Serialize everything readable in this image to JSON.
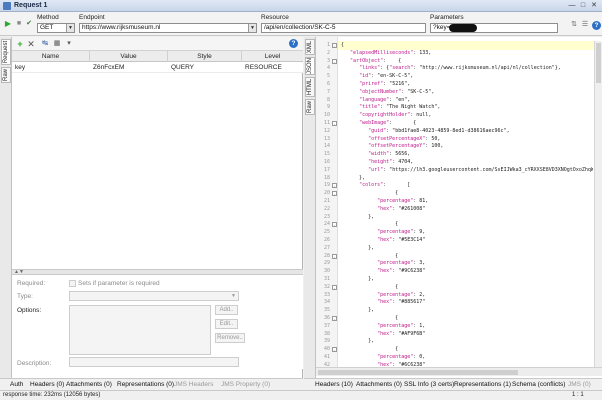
{
  "window": {
    "title": "Request 1"
  },
  "toolbar": {
    "method_label": "Method",
    "method_value": "GET",
    "endpoint_label": "Endpoint",
    "endpoint_value": "https://www.rijksmuseum.nl",
    "resource_label": "Resource",
    "resource_value": "/api/en/collection/SK-C-5",
    "parameters_label": "Parameters",
    "parameters_value": "?key="
  },
  "request_tabs": {
    "request": "Request",
    "raw": "Raw"
  },
  "params_table": {
    "headers": [
      "Name",
      "Value",
      "Style",
      "Level"
    ],
    "rows": [
      {
        "name": "key",
        "value": "Z6nFcxEM",
        "style": "QUERY",
        "level": "RESOURCE"
      }
    ]
  },
  "param_props": {
    "required_label": "Required:",
    "required_checkbox_label": "Sets if parameter is required",
    "type_label": "Type:",
    "options_label": "Options:",
    "description_label": "Description:",
    "add_button": "Add..",
    "edit_button": "Edit..",
    "remove_button": "Remove.."
  },
  "bottom_tabs_left": [
    {
      "label": "Auth",
      "enabled": true
    },
    {
      "label": "Headers (0)",
      "enabled": true
    },
    {
      "label": "Attachments (0)",
      "enabled": true
    },
    {
      "label": "Representations (0)",
      "enabled": true
    },
    {
      "label": "JMS Headers",
      "enabled": false
    },
    {
      "label": "JMS Property (0)",
      "enabled": false
    }
  ],
  "response_tabs": {
    "xml": "XML",
    "json": "JSON",
    "html": "HTML",
    "raw": "Raw"
  },
  "bottom_tabs_right": [
    {
      "label": "Headers (10)",
      "enabled": true
    },
    {
      "label": "Attachments (0)",
      "enabled": true
    },
    {
      "label": "SSL Info (3 certs)",
      "enabled": true
    },
    {
      "label": "Representations (1)",
      "enabled": true
    },
    {
      "label": "Schema (conflicts)",
      "enabled": true
    },
    {
      "label": "JMS (0)",
      "enabled": false
    }
  ],
  "json_lines": [
    {
      "n": "1",
      "text": "{"
    },
    {
      "n": "2",
      "text": "   \"elapsedMilliseconds\": 133,"
    },
    {
      "n": "3",
      "text": "   \"artObject\":    {"
    },
    {
      "n": "4",
      "text": "      \"links\": {\"search\": \"http://www.rijksmuseum.nl/api/nl/collection\"},"
    },
    {
      "n": "5",
      "text": "      \"id\": \"en-SK-C-5\","
    },
    {
      "n": "6",
      "text": "      \"priref\": \"5216\","
    },
    {
      "n": "7",
      "text": "      \"objectNumber\": \"SK-C-5\","
    },
    {
      "n": "8",
      "text": "      \"language\": \"en\","
    },
    {
      "n": "9",
      "text": "      \"title\": \"The Night Watch\","
    },
    {
      "n": "10",
      "text": "      \"copyrightHolder\": null,"
    },
    {
      "n": "11",
      "text": "      \"webImage\":       {"
    },
    {
      "n": "12",
      "text": "         \"guid\": \"bbd1fae8-4023-4859-8ed1-d38616aec96c\","
    },
    {
      "n": "13",
      "text": "         \"offsetPercentageX\": 50,"
    },
    {
      "n": "14",
      "text": "         \"offsetPercentageY\": 100,"
    },
    {
      "n": "15",
      "text": "         \"width\": 5656,"
    },
    {
      "n": "16",
      "text": "         \"height\": 4704,"
    },
    {
      "n": "17",
      "text": "         \"url\": \"https://lh3.googleusercontent.com/SsEIJWka3_cYRXXSE8VD3XNOgtOxoZhqW1uB6UFj78eg"
    },
    {
      "n": "18",
      "text": "      },"
    },
    {
      "n": "19",
      "text": "      \"colors\":       ["
    },
    {
      "n": "20",
      "text": "                  {"
    },
    {
      "n": "21",
      "text": "            \"percentage\": 81,"
    },
    {
      "n": "22",
      "text": "            \"hex\": \"#261008\""
    },
    {
      "n": "23",
      "text": "         },"
    },
    {
      "n": "24",
      "text": "                  {"
    },
    {
      "n": "25",
      "text": "            \"percentage\": 9,"
    },
    {
      "n": "26",
      "text": "            \"hex\": \"#5E3C14\""
    },
    {
      "n": "27",
      "text": "         },"
    },
    {
      "n": "28",
      "text": "                  {"
    },
    {
      "n": "29",
      "text": "            \"percentage\": 3,"
    },
    {
      "n": "30",
      "text": "            \"hex\": \"#9C6238\""
    },
    {
      "n": "31",
      "text": "         },"
    },
    {
      "n": "32",
      "text": "                  {"
    },
    {
      "n": "33",
      "text": "            \"percentage\": 2,"
    },
    {
      "n": "34",
      "text": "            \"hex\": \"#885617\""
    },
    {
      "n": "35",
      "text": "         },"
    },
    {
      "n": "36",
      "text": "                  {"
    },
    {
      "n": "37",
      "text": "            \"percentage\": 1,"
    },
    {
      "n": "38",
      "text": "            \"hex\": \"#AF9F6B\""
    },
    {
      "n": "39",
      "text": "         },"
    },
    {
      "n": "40",
      "text": "                  {"
    },
    {
      "n": "41",
      "text": "            \"percentage\": 0,"
    },
    {
      "n": "42",
      "text": "            \"hex\": \"#6C6238\""
    }
  ],
  "status": {
    "response_time": "response time: 232ms (12056 bytes)",
    "position": "1 : 1"
  },
  "colors": {
    "accent": "#2d6fc7",
    "json_key": "#c0188a",
    "json_number": "#1a1a9a",
    "highlight": "#ffffd0"
  }
}
